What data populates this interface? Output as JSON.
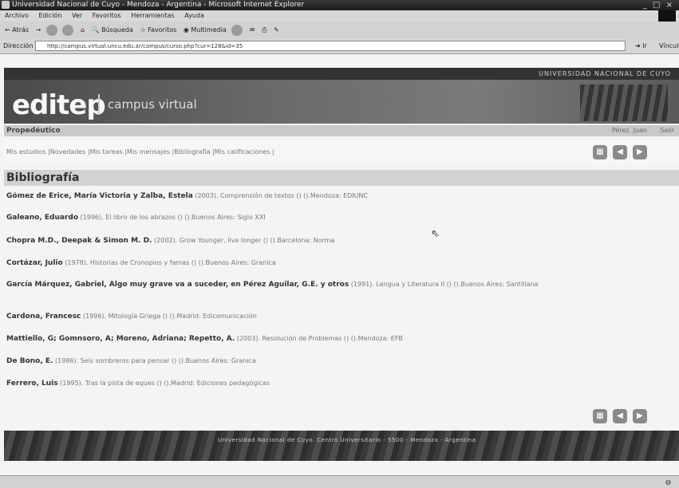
{
  "window": {
    "title": "Universidad Nacional de Cuyo - Mendoza - Argentina - Microsoft Internet Explorer",
    "controls": "_ □ ×"
  },
  "menu": [
    "Archivo",
    "Edición",
    "Ver",
    "Favoritos",
    "Herramientas",
    "Ayuda"
  ],
  "toolbar": {
    "back": "Atrás",
    "search": "Búsqueda",
    "favorites": "Favoritos",
    "multimedia": "Multimedia"
  },
  "address": {
    "label": "Dirección",
    "url": "http://campus.virtual.uncu.edu.ar/campus/curso.php?cur=128&id=35",
    "go": "Ir",
    "links": "Vínculos"
  },
  "site": {
    "top_strip": "UNIVERSIDAD NACIONAL DE CUYO",
    "logo": "editep",
    "logo_sub": "campus virtual",
    "course": "Propedéutico",
    "user": "Pérez, Juan",
    "logout": "Salir",
    "nav_links": [
      "Mis estudios",
      "Novedades",
      "Mis tareas",
      "Mis mensajes",
      "Bibliografía",
      "Mis calificaciones"
    ],
    "nav_buttons": [
      "home",
      "prev",
      "next"
    ],
    "section_title": "Bibliografía",
    "footer": "Universidad Nacional de Cuyo. Centro Universitario - 5500 - Mendoza - Argentina"
  },
  "bibliography": [
    {
      "author": "Gómez de Erice, María Victoria y Zalba, Estela",
      "rest": " (2003). Comprensión de textos () ().Mendoza: EDIUNC"
    },
    {
      "author": "Galeano, Eduardo",
      "rest": " (1996). El libro de los abrazos () ().Buenos Aires: Siglo XXI"
    },
    {
      "author": "Chopra M.D., Deepak & Simon M. D.",
      "rest": " (2002). Grow Younger, live longer () ().Barcelona: Norma"
    },
    {
      "author": "Cortázar, Julio",
      "rest": " (1978). Historias de Cronopios y famas () ().Buenos Aires: Granica"
    },
    {
      "author": "García Márquez, Gabriel, Algo muy grave va a suceder, en Pérez Aguilar, G.E. y otros",
      "rest": " (1991). Lengua y Literatura II () ().Buenos Aires: Santillana"
    },
    {
      "author": "Cardona, Francesc",
      "rest": " (1996). Mitología Griega () ().Madrid: Edicomunicación"
    },
    {
      "author": "Mattiello, G; Gomnsoro, A; Moreno, Adriana; Repetto, A.",
      "rest": " (2003). Resolución de Problemas () ().Mendoza: EFB"
    },
    {
      "author": "De Bono, E.",
      "rest": " (1986). Seis sombreros para pensar () ().Buenos Aires: Granica"
    },
    {
      "author": "Ferrero, Luis",
      "rest": " (1995). Tras la pista de eques () ().Madrid: Ediciones pedagógicas"
    }
  ],
  "icons": {
    "home": "grid-icon",
    "prev": "arrow-left-icon",
    "next": "arrow-right-icon"
  },
  "colors": {
    "header_dark": "#333333",
    "section_bg": "#d2d2d2",
    "page_bg": "#f4f4f4"
  }
}
